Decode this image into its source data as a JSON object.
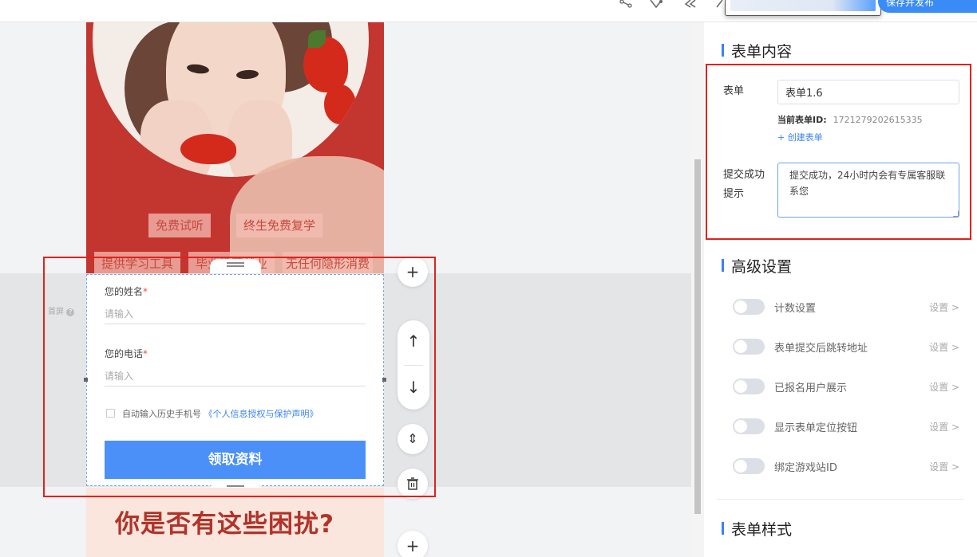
{
  "toolbar": {
    "icons": [
      "share-icon",
      "checkmark-shield-icon",
      "undo-icon",
      "redo-icon"
    ],
    "publish_label": "保存并发布"
  },
  "hero": {
    "tags": [
      "免费试听",
      "终生免费复学",
      "提供学习工具",
      "毕业推荐就业",
      "无任何隐形消费"
    ]
  },
  "form": {
    "name_label": "您的姓名",
    "name_placeholder": "请输入",
    "phone_label": "您的电话",
    "phone_placeholder": "请输入",
    "required_mark": "*",
    "autofill_text": "自动输入历史手机号",
    "privacy_link": "《个人信息授权与保护声明》",
    "submit_label": "领取资料"
  },
  "canvas": {
    "first_screen_label": "首屏",
    "first_screen_icon": "?",
    "trouble_title": "你是否有这些困扰?"
  },
  "side_actions": {
    "add": "+",
    "up": "↑",
    "down": "↓",
    "fold": "⇕",
    "delete": "🗑"
  },
  "panel": {
    "form_content_title": "表单内容",
    "form_label": "表单",
    "form_value": "表单1.6",
    "form_id_label": "当前表单ID:",
    "form_id_value": "1721279202615335",
    "create_form_label": "+ 创建表单",
    "success_label_line1": "提交成功",
    "success_label_line2": "提示",
    "success_text": "提交成功，24小时内会有专属客服联系您",
    "advanced_title": "高级设置",
    "settings": [
      {
        "label": "计数设置",
        "link": "设置 >",
        "enabled": false
      },
      {
        "label": "表单提交后跳转地址",
        "link": "设置 >",
        "enabled": false
      },
      {
        "label": "已报名用户展示",
        "link": "设置 >",
        "enabled": false
      },
      {
        "label": "显示表单定位按钮",
        "link": "设置 >",
        "enabled": false
      },
      {
        "label": "绑定游戏站ID",
        "link": "设置 >",
        "enabled": false
      }
    ],
    "style_title": "表单样式"
  },
  "colors": {
    "accent": "#3b82f6",
    "button": "#4a90f8",
    "highlight_box": "#e3211c",
    "hero_red": "#c3352f",
    "trouble_text": "#b1332a"
  }
}
